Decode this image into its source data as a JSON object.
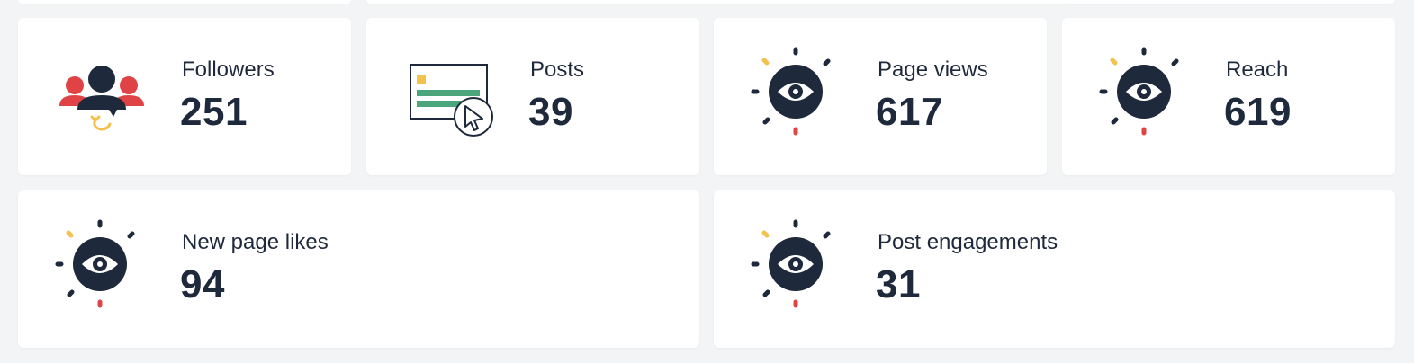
{
  "colors": {
    "background": "#f3f4f5",
    "card": "#ffffff",
    "navy": "#1e2a3b",
    "red": "#e04345",
    "yellow": "#f2c14e",
    "green": "#4ca67d"
  },
  "metrics": [
    {
      "label": "Followers",
      "value": "251",
      "icon": "followers-icon"
    },
    {
      "label": "Posts",
      "value": "39",
      "icon": "posts-icon"
    },
    {
      "label": "Page views",
      "value": "617",
      "icon": "eye-icon"
    },
    {
      "label": "Reach",
      "value": "619",
      "icon": "eye-icon"
    },
    {
      "label": "New page likes",
      "value": "94",
      "icon": "eye-icon"
    },
    {
      "label": "Post engagements",
      "value": "31",
      "icon": "eye-icon"
    }
  ]
}
